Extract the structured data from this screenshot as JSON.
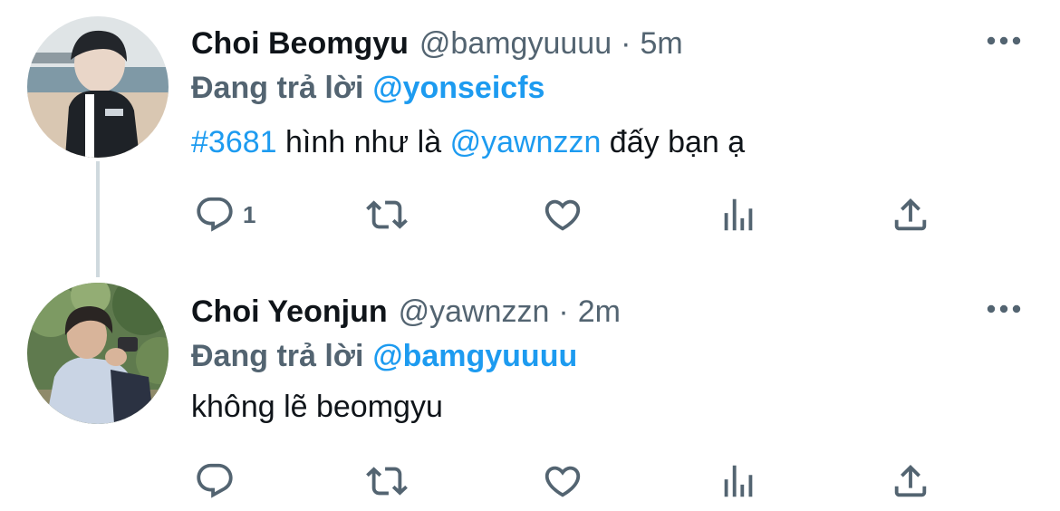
{
  "colors": {
    "accent": "#1d9bf0",
    "secondary_text": "#536471",
    "primary_text": "#0f1419",
    "thread_line": "#cfd9de"
  },
  "tweets": [
    {
      "display_name": "Choi Beomgyu",
      "handle": "@bamgyuuuu",
      "separator": "·",
      "time": "5m",
      "replying_label": "Đang trả lời",
      "replying_to": "@yonseicfs",
      "hashtag": "#3681",
      "text_part1": " hình như là ",
      "mention": "@yawnzzn",
      "text_part2": " đấy bạn ạ",
      "reply_count": "1",
      "icons": {
        "more": "more-dots-icon",
        "reply": "reply-bubble-icon",
        "retweet": "retweet-icon",
        "like": "heart-icon",
        "analytics": "analytics-icon",
        "share": "share-icon"
      }
    },
    {
      "display_name": "Choi Yeonjun",
      "handle": "@yawnzzn",
      "separator": "·",
      "time": "2m",
      "replying_label": "Đang trả lời",
      "replying_to": "@bamgyuuuu",
      "text": "không lẽ beomgyu",
      "icons": {
        "more": "more-dots-icon",
        "reply": "reply-bubble-icon",
        "retweet": "retweet-icon",
        "like": "heart-icon",
        "analytics": "analytics-icon",
        "share": "share-icon"
      }
    }
  ]
}
